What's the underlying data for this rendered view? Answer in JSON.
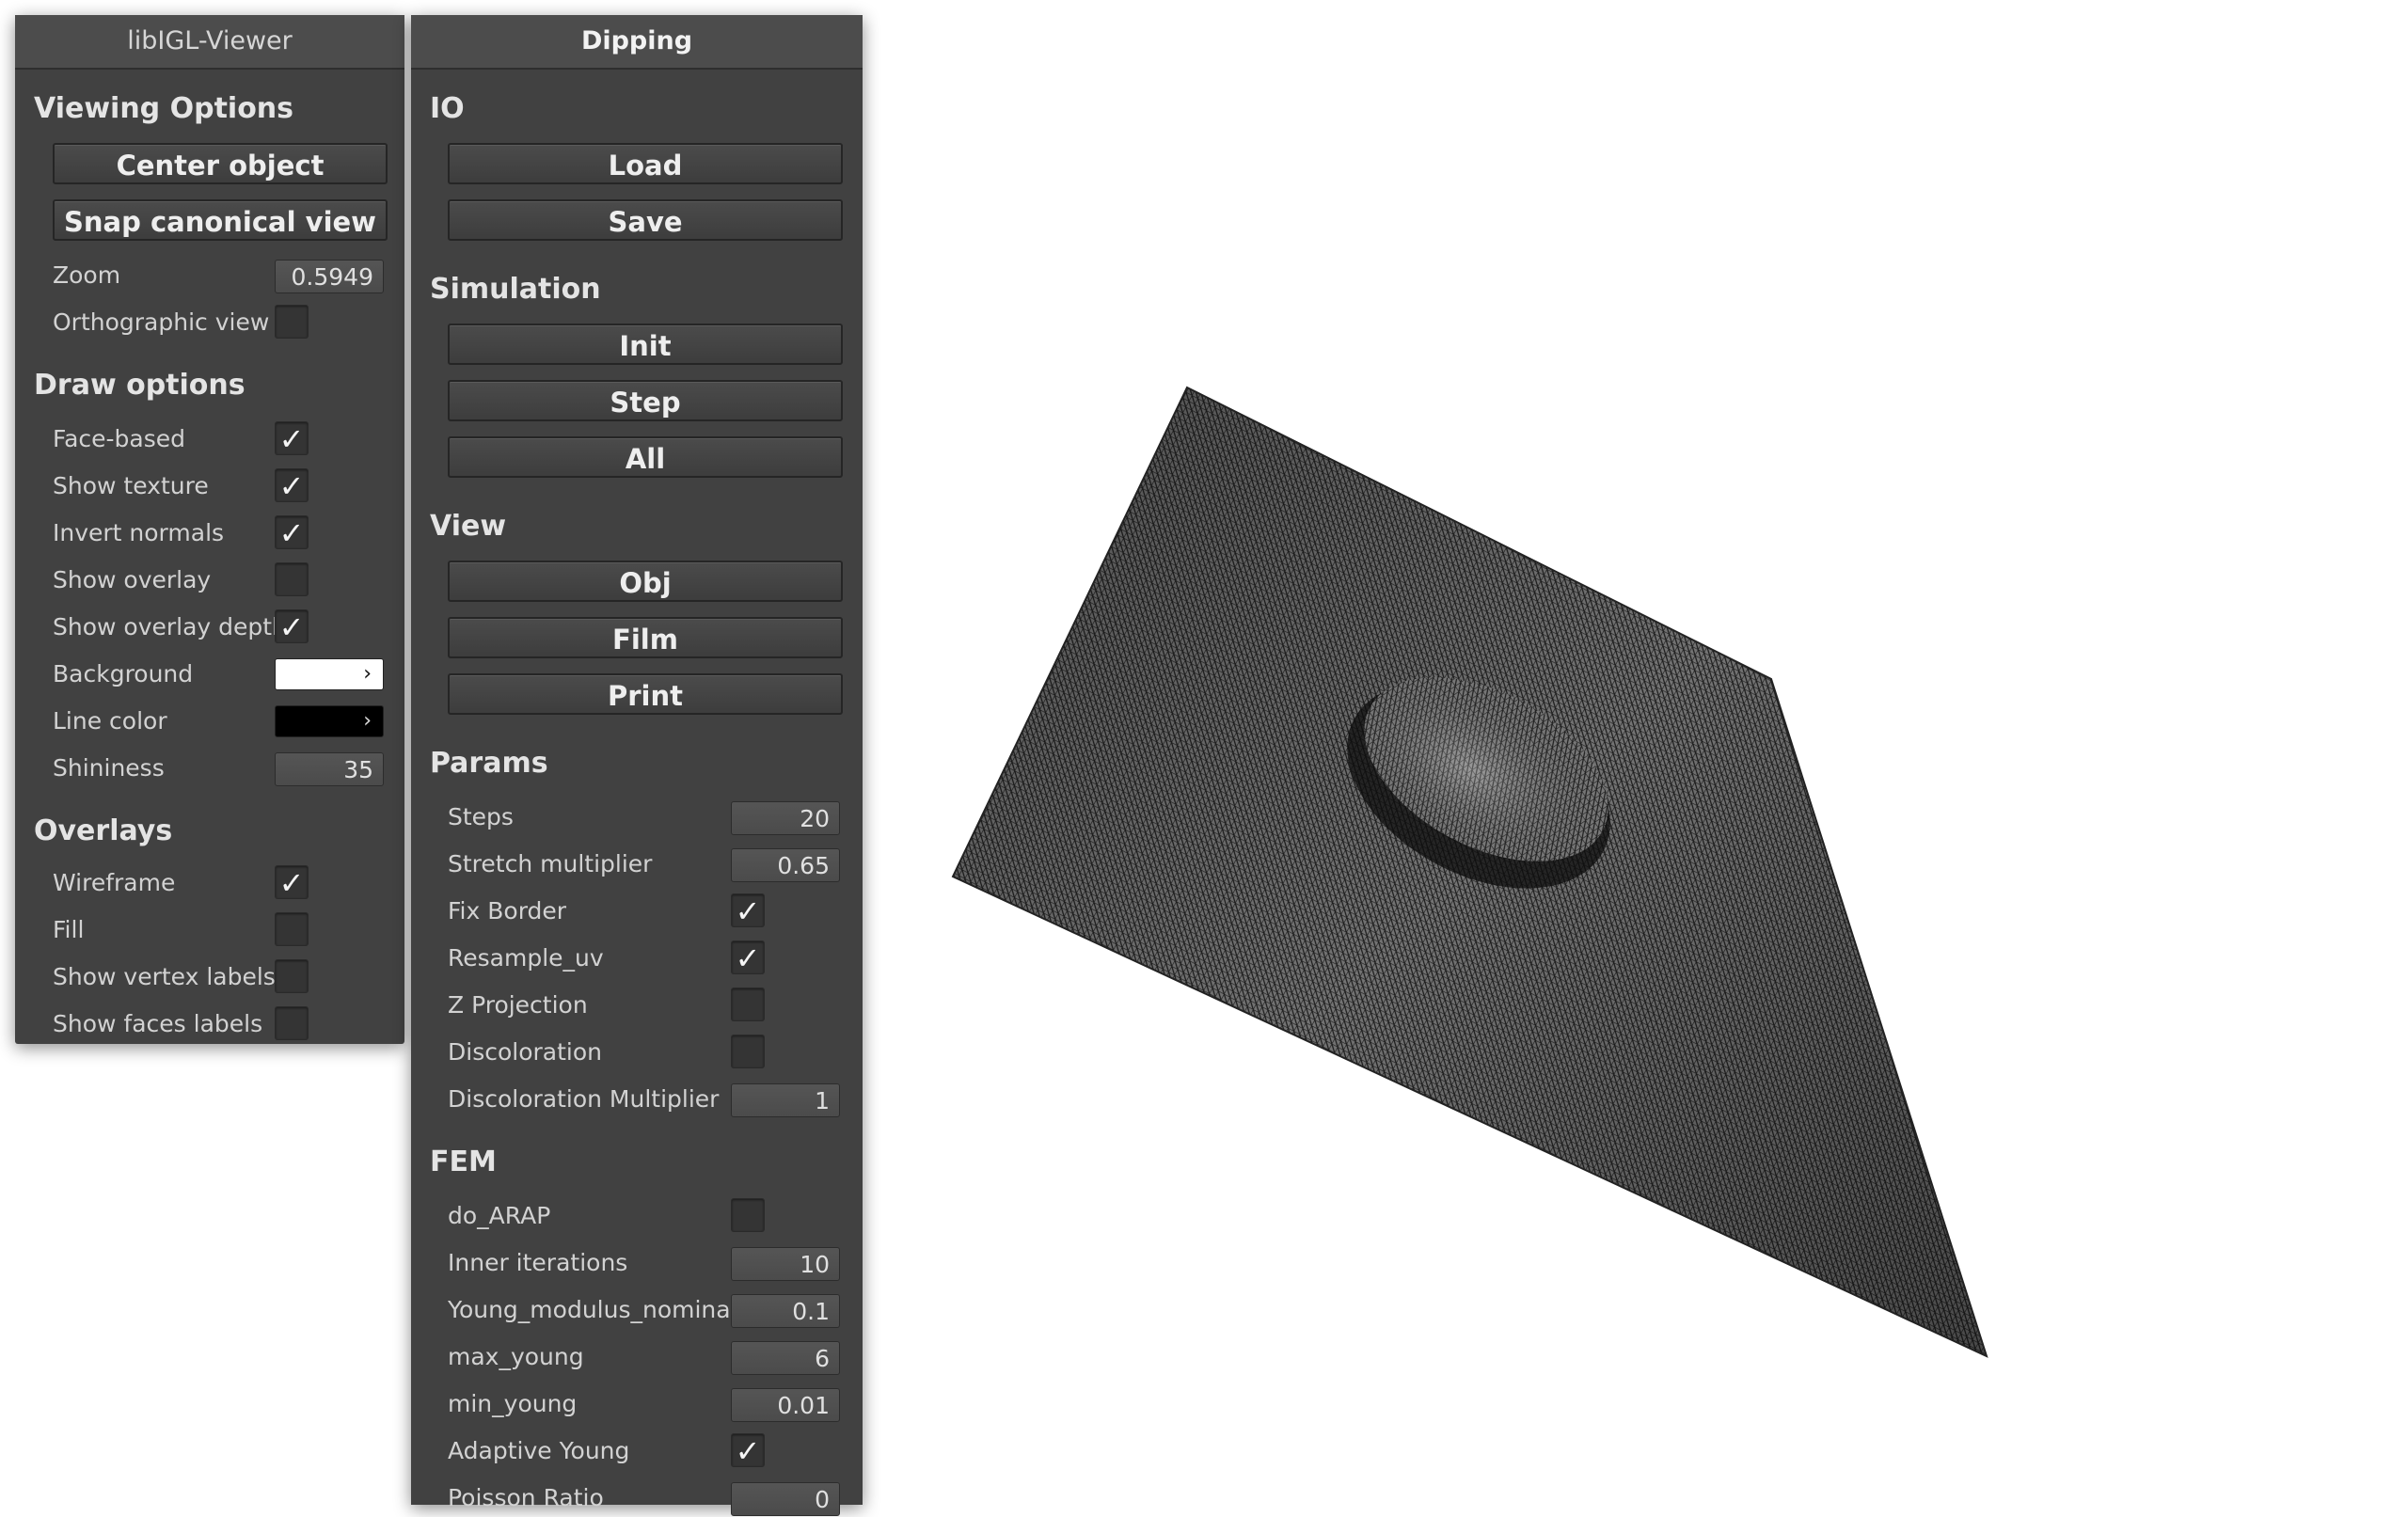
{
  "viewer": {
    "title": "libIGL-Viewer",
    "viewing_options": {
      "heading": "Viewing Options",
      "center_object": "Center object",
      "snap_canonical": "Snap canonical view",
      "zoom_label": "Zoom",
      "zoom_value": "0.5949",
      "orthographic_label": "Orthographic view",
      "orthographic_checked": false
    },
    "draw_options": {
      "heading": "Draw options",
      "face_based": "Face-based",
      "show_texture": "Show texture",
      "invert_normals": "Invert normals",
      "show_overlay": "Show overlay",
      "show_overlay_depth": "Show overlay depth",
      "background_label": "Background",
      "background_color": "#ffffff",
      "line_color_label": "Line color",
      "line_color": "#000000",
      "shininess_label": "Shininess",
      "shininess_value": "35",
      "arrow": "›"
    },
    "overlays": {
      "heading": "Overlays",
      "wireframe": "Wireframe",
      "fill": "Fill",
      "show_vertex_labels": "Show vertex labels",
      "show_faces_labels": "Show faces labels"
    }
  },
  "dipping": {
    "title": "Dipping",
    "io": {
      "heading": "IO",
      "load": "Load",
      "save": "Save"
    },
    "simulation": {
      "heading": "Simulation",
      "init": "Init",
      "step": "Step",
      "all": "All"
    },
    "view": {
      "heading": "View",
      "obj": "Obj",
      "film": "Film",
      "print": "Print"
    },
    "params": {
      "heading": "Params",
      "steps_label": "Steps",
      "steps_value": "20",
      "stretch_label": "Stretch multiplier",
      "stretch_value": "0.65",
      "fix_border": "Fix Border",
      "resample_uv": "Resample_uv",
      "z_projection": "Z Projection",
      "discoloration": "Discoloration",
      "discoloration_mult_label": "Discoloration Multiplier",
      "discoloration_mult_value": "1"
    },
    "fem": {
      "heading": "FEM",
      "do_arap": "do_ARAP",
      "inner_iter_label": "Inner iterations",
      "inner_iter_value": "10",
      "young_nominal_label": "Young_modulus_nominal",
      "young_nominal_value": "0.1",
      "max_young_label": "max_young",
      "max_young_value": "6",
      "min_young_label": "min_young",
      "min_young_value": "0.01",
      "adaptive_young": "Adaptive Young",
      "poisson_label": "Poisson Ratio",
      "poisson_value": "0"
    }
  },
  "check_glyph": "✓"
}
